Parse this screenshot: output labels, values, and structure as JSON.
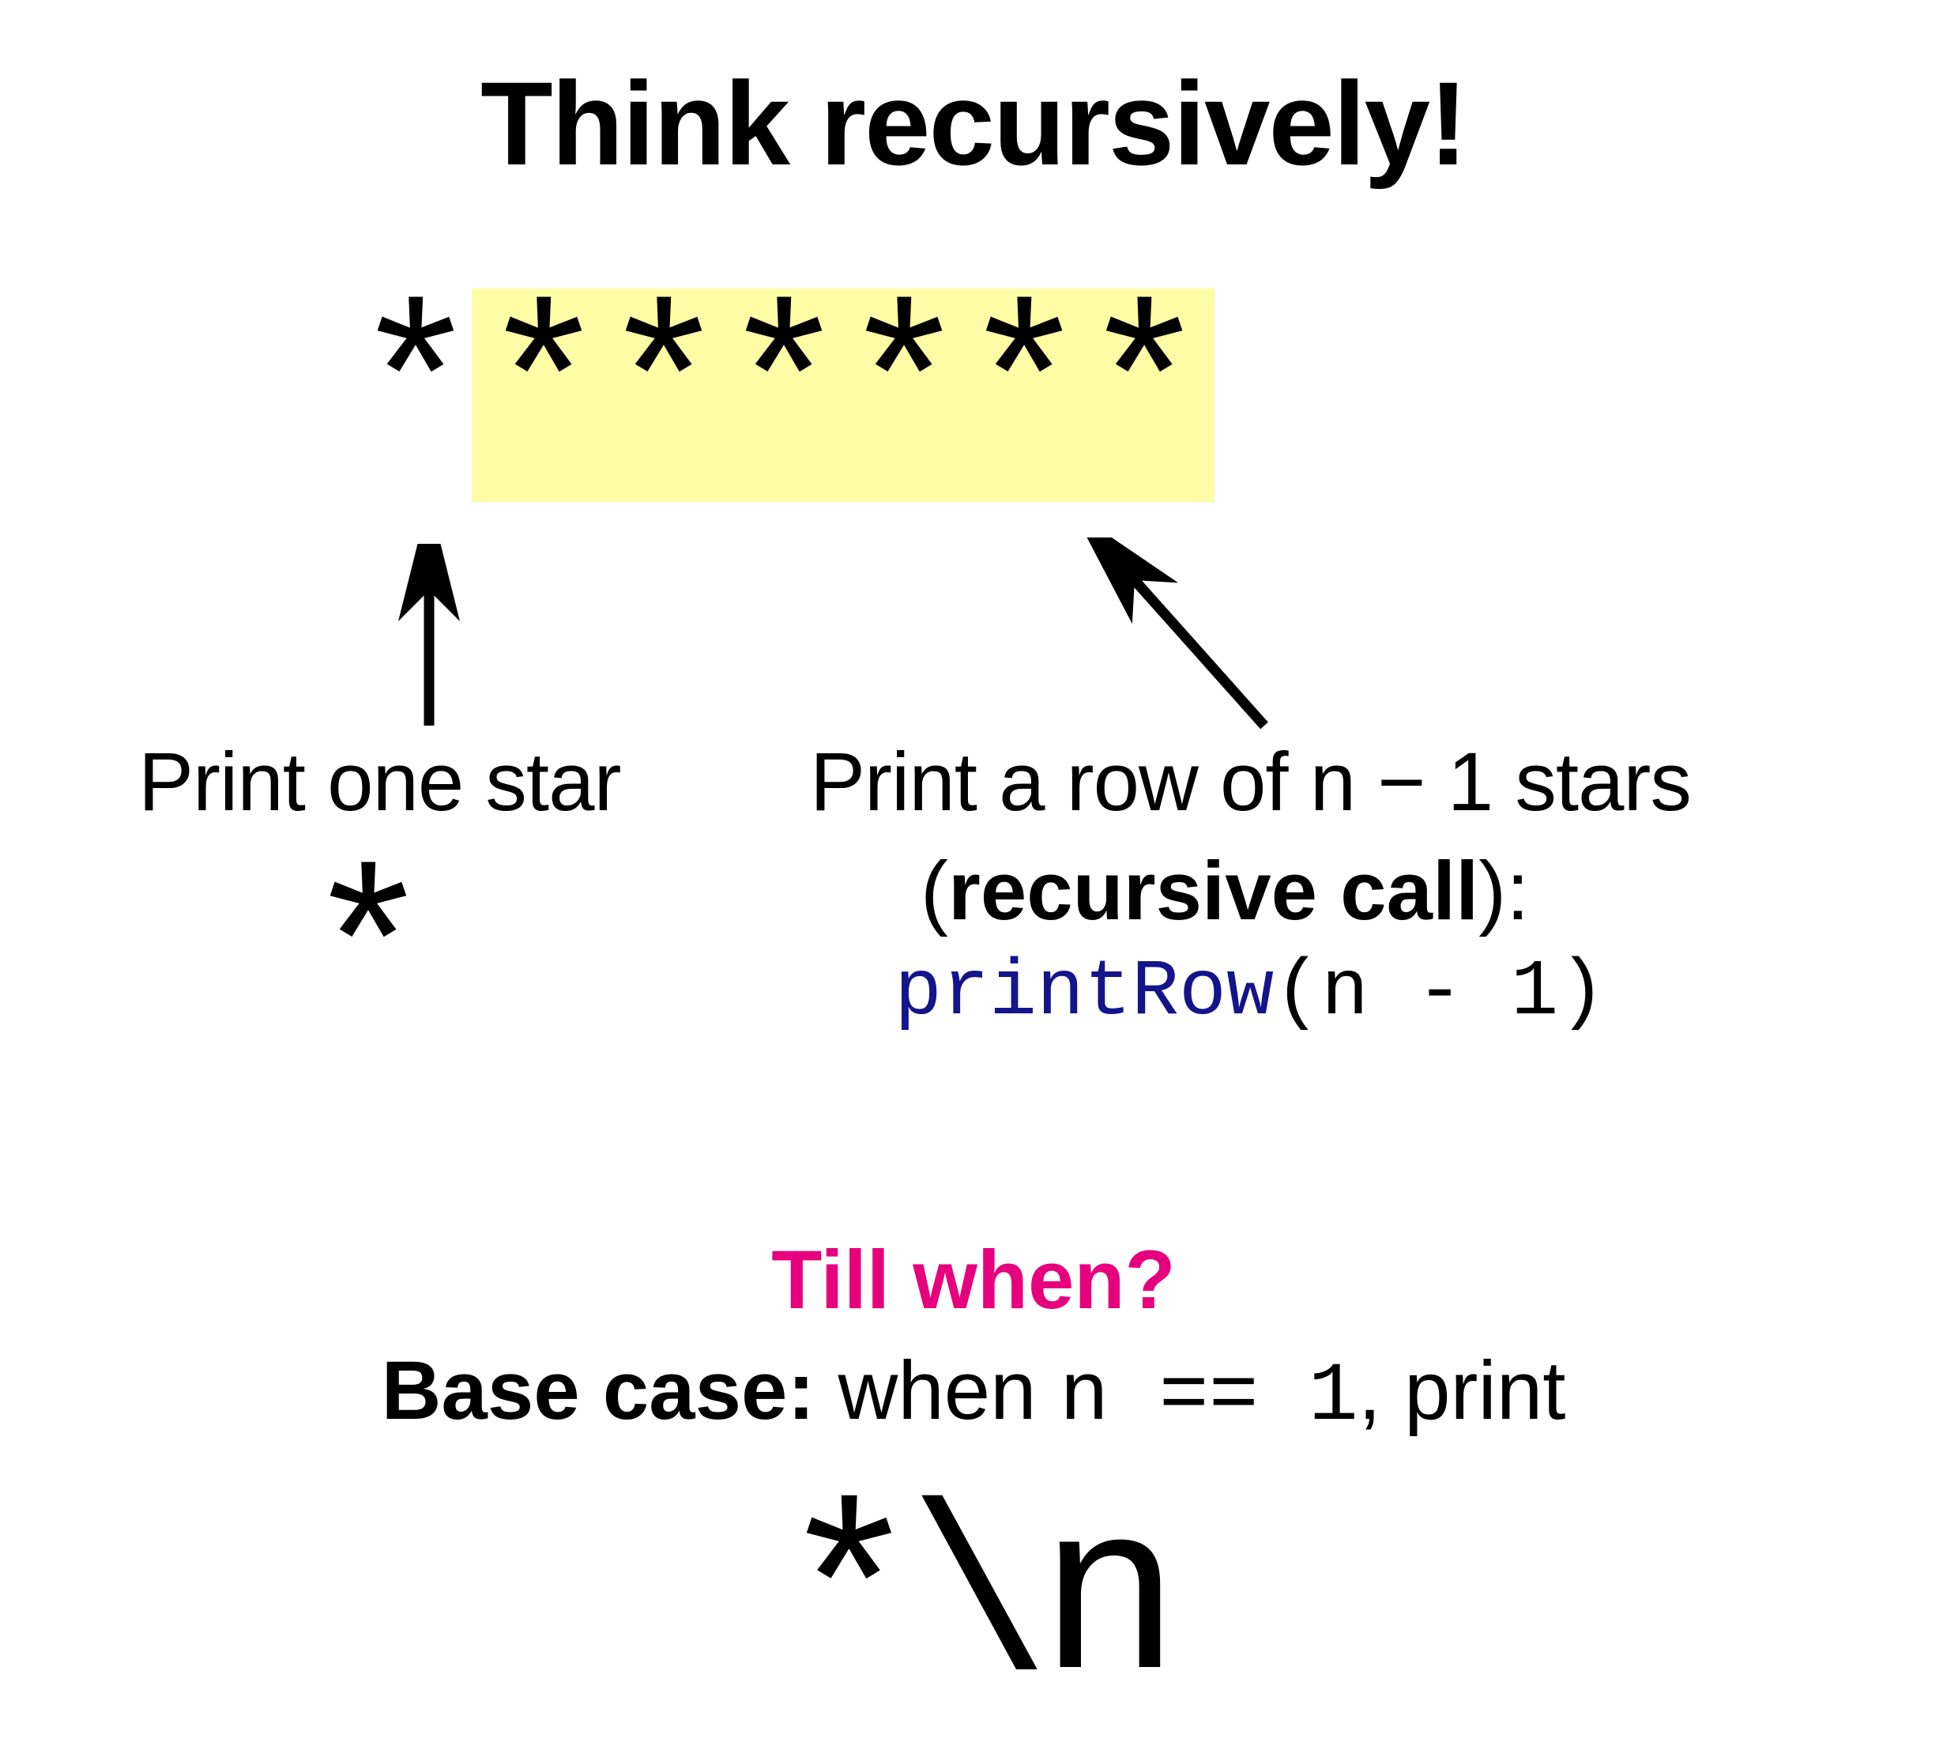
{
  "title": "Think recursively!",
  "stars": {
    "first": "*",
    "rest": "******"
  },
  "labels": {
    "left": "Print one star",
    "right": "Print a row of n − 1 stars",
    "recursive_open": "(",
    "recursive_bold": "recursive call",
    "recursive_close": "):",
    "code_fn": "printRow",
    "code_args": "(n - 1)"
  },
  "lone_star": "*",
  "tillwhen": "Till when?",
  "basecase": {
    "bold": "Base case:",
    "rest_pre": " when ",
    "cond": "n == 1",
    "rest_post": ", print"
  },
  "final": "*\\n"
}
